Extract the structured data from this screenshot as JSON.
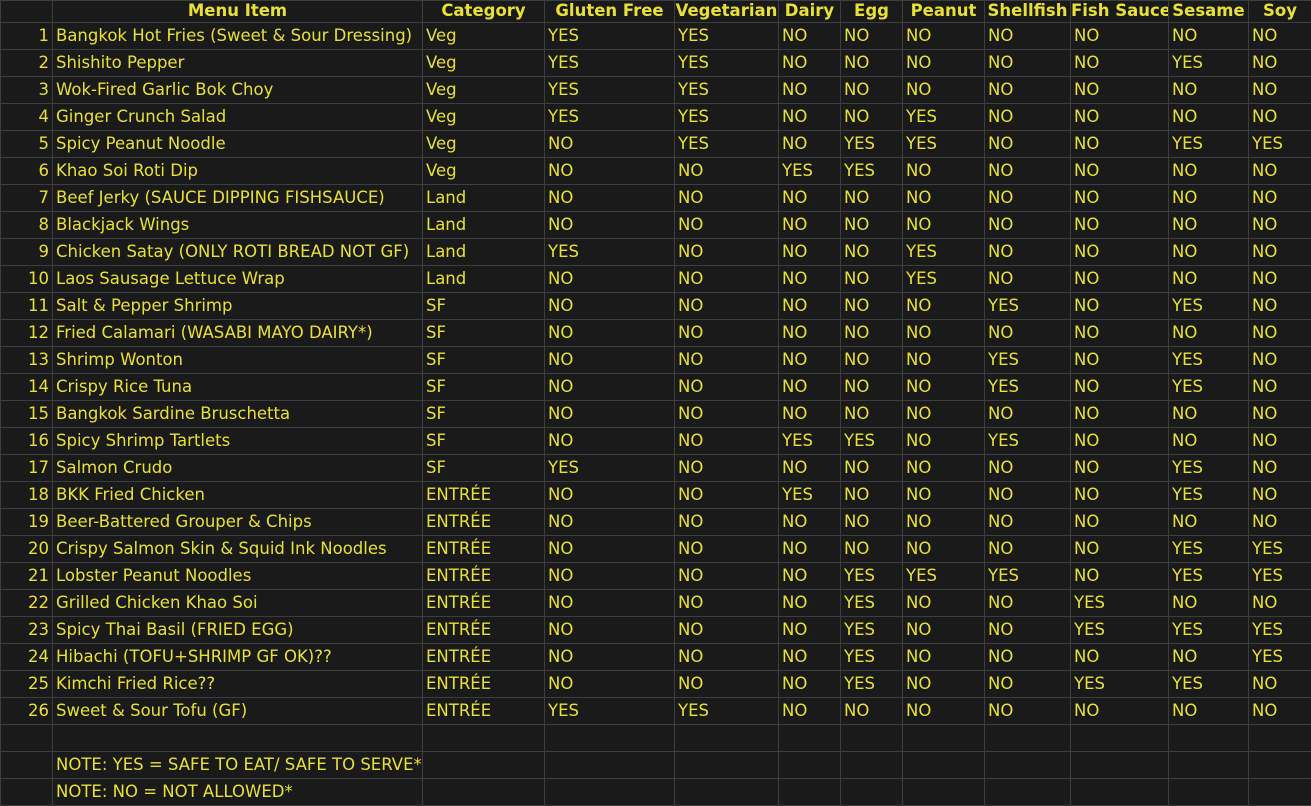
{
  "columns": [
    "",
    "Menu Item",
    "Category",
    "Gluten Free",
    "Vegetarian",
    "Dairy",
    "Egg",
    "Peanut",
    "Shellfish",
    "Fish Sauce",
    "Sesame",
    "Soy"
  ],
  "rows": [
    [
      "1",
      "Bangkok Hot Fries (Sweet & Sour Dressing)",
      "Veg",
      "YES",
      "YES",
      "NO",
      "NO",
      "NO",
      "NO",
      "NO",
      "NO",
      "NO"
    ],
    [
      "2",
      "Shishito Pepper",
      "Veg",
      "YES",
      "YES",
      "NO",
      "NO",
      "NO",
      "NO",
      "NO",
      "YES",
      "NO"
    ],
    [
      "3",
      "Wok-Fired Garlic Bok Choy",
      "Veg",
      "YES",
      "YES",
      "NO",
      "NO",
      "NO",
      "NO",
      "NO",
      "NO",
      "NO"
    ],
    [
      "4",
      "Ginger Crunch Salad",
      "Veg",
      "YES",
      "YES",
      "NO",
      "NO",
      "YES",
      "NO",
      "NO",
      "NO",
      "NO"
    ],
    [
      "5",
      "Spicy Peanut Noodle",
      "Veg",
      "NO",
      "YES",
      "NO",
      "YES",
      "YES",
      "NO",
      "NO",
      "YES",
      "YES"
    ],
    [
      "6",
      "Khao Soi Roti Dip",
      "Veg",
      "NO",
      "NO",
      "YES",
      "YES",
      "NO",
      "NO",
      "NO",
      "NO",
      "NO"
    ],
    [
      "7",
      "Beef Jerky (SAUCE DIPPING FISHSAUCE)",
      "Land",
      "NO",
      "NO",
      "NO",
      "NO",
      "NO",
      "NO",
      "NO",
      "NO",
      "NO"
    ],
    [
      "8",
      "Blackjack Wings",
      "Land",
      "NO",
      "NO",
      "NO",
      "NO",
      "NO",
      "NO",
      "NO",
      "NO",
      "NO"
    ],
    [
      "9",
      "Chicken Satay (ONLY ROTI BREAD NOT GF)",
      "Land",
      "YES",
      "NO",
      "NO",
      "NO",
      "YES",
      "NO",
      "NO",
      "NO",
      "NO"
    ],
    [
      "10",
      "Laos Sausage Lettuce Wrap",
      "Land",
      "NO",
      "NO",
      "NO",
      "NO",
      "YES",
      "NO",
      "NO",
      "NO",
      "NO"
    ],
    [
      "11",
      "Salt & Pepper Shrimp",
      "SF",
      "NO",
      "NO",
      "NO",
      "NO",
      "NO",
      "YES",
      "NO",
      "YES",
      "NO"
    ],
    [
      "12",
      "Fried Calamari (WASABI MAYO DAIRY*)",
      "SF",
      "NO",
      "NO",
      "NO",
      "NO",
      "NO",
      "NO",
      "NO",
      "NO",
      "NO"
    ],
    [
      "13",
      "Shrimp Wonton",
      "SF",
      "NO",
      "NO",
      "NO",
      "NO",
      "NO",
      "YES",
      "NO",
      "YES",
      "NO"
    ],
    [
      "14",
      "Crispy Rice Tuna",
      "SF",
      "NO",
      "NO",
      "NO",
      "NO",
      "NO",
      "YES",
      "NO",
      "YES",
      "NO"
    ],
    [
      "15",
      "Bangkok Sardine Bruschetta",
      "SF",
      "NO",
      "NO",
      "NO",
      "NO",
      "NO",
      "NO",
      "NO",
      "NO",
      "NO"
    ],
    [
      "16",
      "Spicy Shrimp Tartlets",
      "SF",
      "NO",
      "NO",
      "YES",
      "YES",
      "NO",
      "YES",
      "NO",
      "NO",
      "NO"
    ],
    [
      "17",
      "Salmon Crudo",
      "SF",
      "YES",
      "NO",
      "NO",
      "NO",
      "NO",
      "NO",
      "NO",
      "YES",
      "NO"
    ],
    [
      "18",
      "BKK Fried Chicken",
      "ENTRÉE",
      "NO",
      "NO",
      "YES",
      "NO",
      "NO",
      "NO",
      "NO",
      "YES",
      "NO"
    ],
    [
      "19",
      "Beer-Battered Grouper & Chips",
      "ENTRÉE",
      "NO",
      "NO",
      "NO",
      "NO",
      "NO",
      "NO",
      "NO",
      "NO",
      "NO"
    ],
    [
      "20",
      "Crispy Salmon Skin & Squid Ink Noodles",
      "ENTRÉE",
      "NO",
      "NO",
      "NO",
      "NO",
      "NO",
      "NO",
      "NO",
      "YES",
      "YES"
    ],
    [
      "21",
      "Lobster Peanut Noodles",
      "ENTRÉE",
      "NO",
      "NO",
      "NO",
      "YES",
      "YES",
      "YES",
      "NO",
      "YES",
      "YES"
    ],
    [
      "22",
      "Grilled Chicken Khao Soi",
      "ENTRÉE",
      "NO",
      "NO",
      "NO",
      "YES",
      "NO",
      "NO",
      "YES",
      "NO",
      "NO"
    ],
    [
      "23",
      "Spicy Thai Basil (FRIED EGG)",
      "ENTRÉE",
      "NO",
      "NO",
      "NO",
      "YES",
      "NO",
      "NO",
      "YES",
      "YES",
      "YES"
    ],
    [
      "24",
      "Hibachi (TOFU+SHRIMP GF OK)??",
      "ENTRÉE",
      "NO",
      "NO",
      "NO",
      "YES",
      "NO",
      "NO",
      "NO",
      "NO",
      "YES"
    ],
    [
      "25",
      "Kimchi Fried Rice??",
      "ENTRÉE",
      "NO",
      "NO",
      "NO",
      "YES",
      "NO",
      "NO",
      "YES",
      "YES",
      "NO"
    ],
    [
      "26",
      "Sweet & Sour Tofu (GF)",
      "ENTRÉE",
      "YES",
      "YES",
      "NO",
      "NO",
      "NO",
      "NO",
      "NO",
      "NO",
      "NO"
    ]
  ],
  "notes": [
    "NOTE:  YES = SAFE TO EAT/ SAFE TO SERVE*",
    "NOTE:  NO = NOT ALLOWED*"
  ],
  "colors": {
    "background": "#1a1a1a",
    "text": "#e8e03a",
    "gridline": "#3d3d3d"
  }
}
